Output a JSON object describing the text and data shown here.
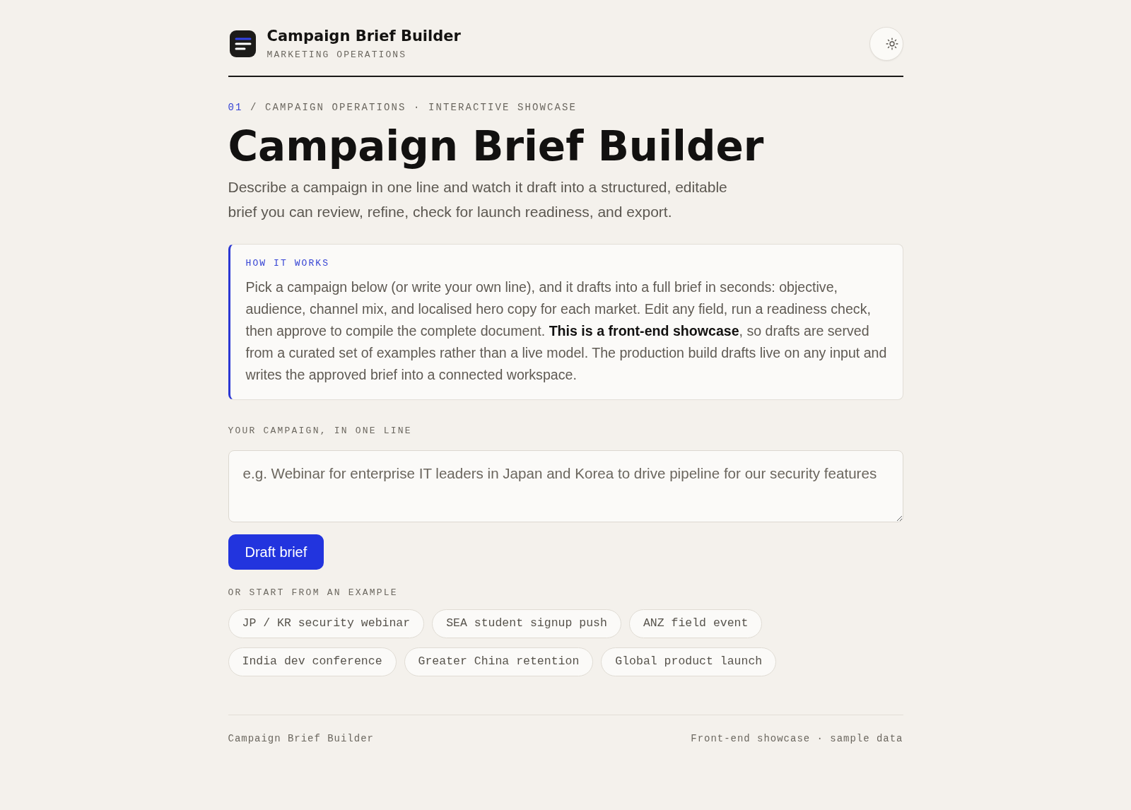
{
  "header": {
    "title": "Campaign Brief Builder",
    "subtitle": "MARKETING OPERATIONS"
  },
  "breadcrumb": {
    "number": "01",
    "text": "/ CAMPAIGN OPERATIONS · INTERACTIVE SHOWCASE"
  },
  "title": "Campaign Brief Builder",
  "description": "Describe a campaign in one line and watch it draft into a structured, editable brief you can review, refine, check for launch readiness, and export.",
  "how_it_works": {
    "label": "HOW IT WORKS",
    "text": "Pick a campaign below (or write your own line), and it drafts into a full brief in seconds: objective, audience, channel mix, and localised hero copy for each market. Edit any field, run a readiness check, then approve to compile the complete document. **This is a front-end showcase**, so drafts are served from a curated set of examples rather than a live model. The production build drafts live on any input and writes the approved brief into a connected workspace."
  },
  "campaign_input": {
    "label": "YOUR CAMPAIGN, IN ONE LINE",
    "placeholder": "e.g. Webinar for enterprise IT leaders in Japan and Korea to drive pipeline for our security features"
  },
  "draft_button": "Draft brief",
  "examples": {
    "label": "OR START FROM AN EXAMPLE",
    "items": [
      "JP / KR security webinar",
      "SEA student signup push",
      "ANZ field event",
      "India dev conference",
      "Greater China retention",
      "Global product launch"
    ]
  },
  "footer": {
    "left": "Campaign Brief Builder",
    "right": "Front-end showcase · sample data"
  }
}
